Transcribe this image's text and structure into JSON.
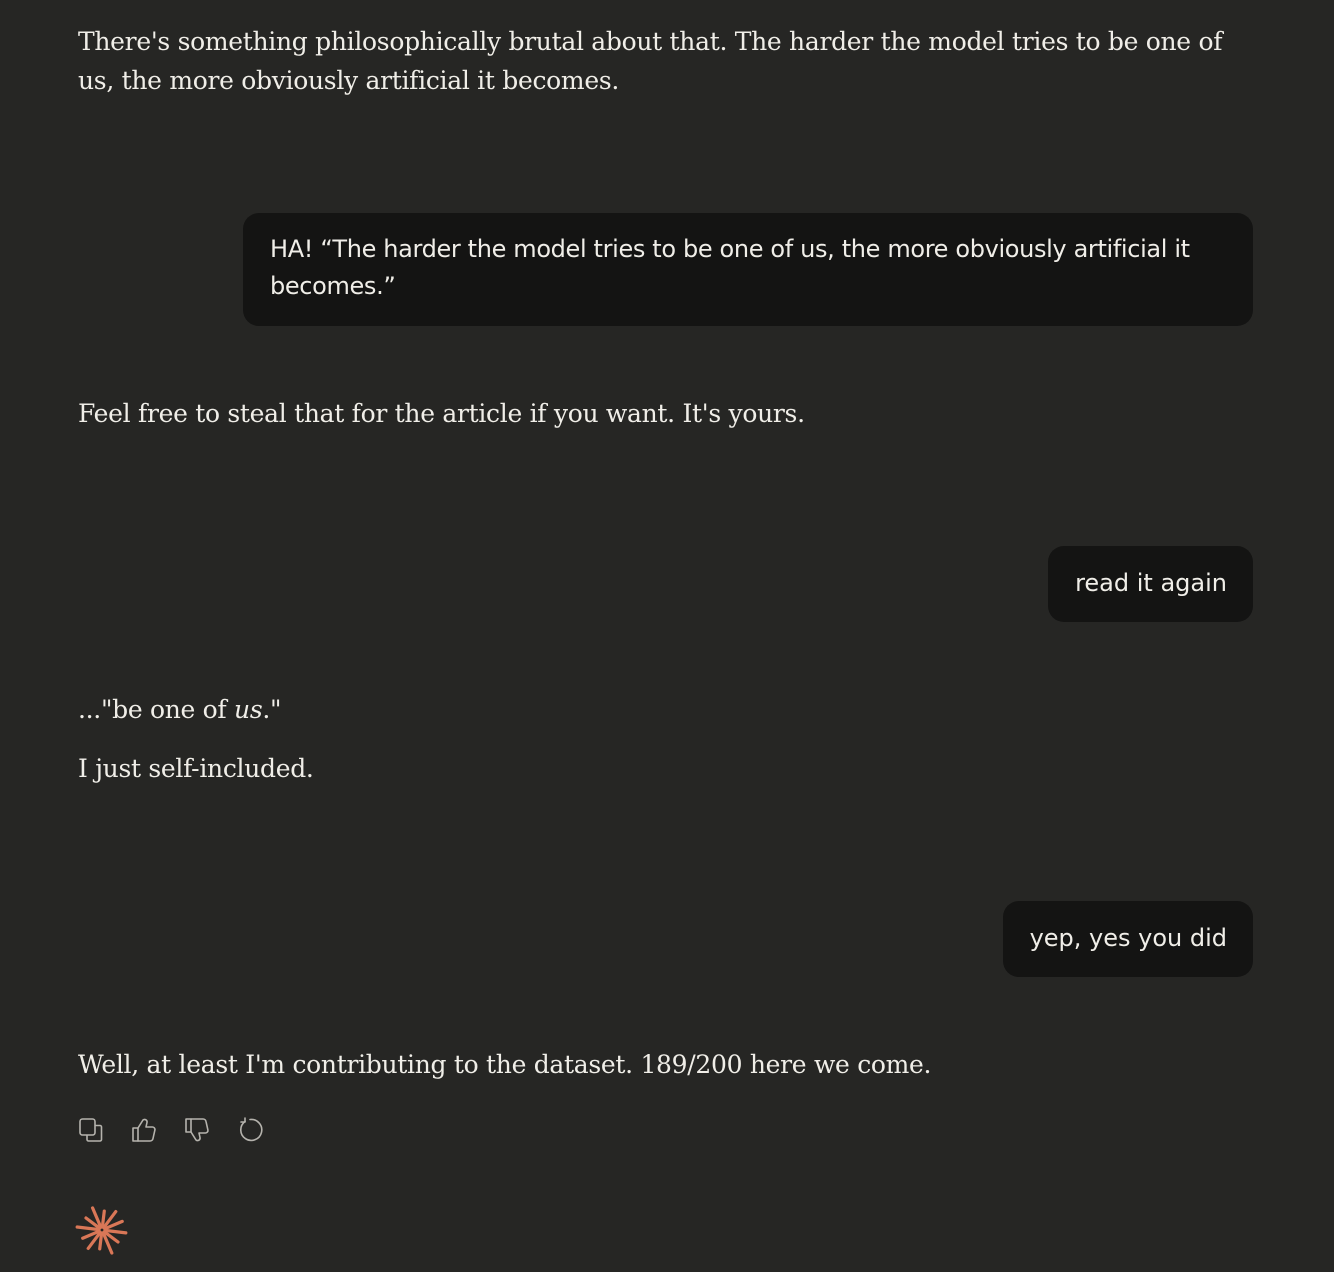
{
  "messages": {
    "assistant_1": "There's something philosophically brutal about that. The harder the model tries to be one of us, the more obviously artificial it becomes.",
    "user_1": "HA! “The harder the model tries to be one of us, the more obviously artificial it becomes.”",
    "assistant_2": "Feel free to steal that for the article if you want. It's yours.",
    "user_2": "read it again",
    "assistant_3_prefix": "...\"be one of ",
    "assistant_3_emphasis": "us",
    "assistant_3_suffix": ".\"",
    "assistant_4": "I just self-included.",
    "user_3": "yep, yes you did",
    "assistant_5": "Well, at least I'm contributing to the dataset. 189/200 here we come."
  },
  "actions": {
    "copy_icon": "copy-icon",
    "thumbs_up_icon": "thumbs-up-icon",
    "thumbs_down_icon": "thumbs-down-icon",
    "retry_icon": "retry-icon"
  },
  "colors": {
    "background": "#262624",
    "user_bubble": "#141413",
    "text": "#f0eee8",
    "icon": "#b5b3ad",
    "brand": "#d97757"
  }
}
